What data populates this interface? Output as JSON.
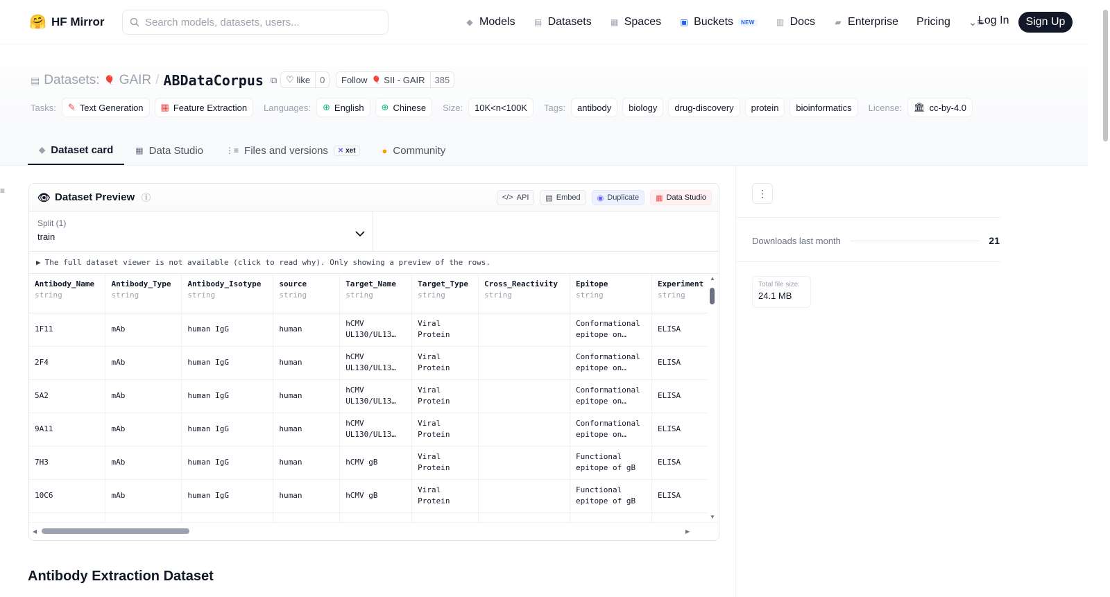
{
  "nav": {
    "logo_text": "HF Mirror",
    "logo_icon": "hugging-face-emoji",
    "search_placeholder": "Search models, datasets, users...",
    "links": [
      {
        "label": "Models",
        "icon": "cube-icon"
      },
      {
        "label": "Datasets",
        "icon": "database-icon"
      },
      {
        "label": "Spaces",
        "icon": "grid-icon"
      },
      {
        "label": "Buckets",
        "icon": "bucket-icon",
        "badge": "NEW"
      },
      {
        "label": "Docs",
        "icon": "book-icon"
      },
      {
        "label": "Enterprise",
        "icon": "enterprise-icon"
      },
      {
        "label": "Pricing"
      }
    ],
    "login": "Log In",
    "signup": "Sign Up"
  },
  "header": {
    "section": "Datasets:",
    "org": "GAIR",
    "separator": "/",
    "name": "ABDataCorpus",
    "like_label": "like",
    "like_count": "0",
    "follow_label": "Follow",
    "follow_org": "SII - GAIR",
    "follow_count": "385"
  },
  "tags": {
    "tasks_label": "Tasks:",
    "tasks": [
      "Text Generation",
      "Feature Extraction"
    ],
    "languages_label": "Languages:",
    "languages": [
      "English",
      "Chinese"
    ],
    "size_label": "Size:",
    "size": "10K<n<100K",
    "tags_label": "Tags:",
    "tags": [
      "antibody",
      "biology",
      "drug-discovery",
      "protein",
      "bioinformatics"
    ],
    "license_label": "License:",
    "license": "cc-by-4.0"
  },
  "tabs": [
    {
      "label": "Dataset card",
      "active": true
    },
    {
      "label": "Data Studio"
    },
    {
      "label": "Files and versions",
      "badge": "xet"
    },
    {
      "label": "Community"
    }
  ],
  "preview": {
    "title": "Dataset Preview",
    "buttons": {
      "api": "API",
      "embed": "Embed",
      "duplicate": "Duplicate",
      "data_studio": "Data Studio"
    },
    "split_label": "Split (1)",
    "split_value": "train",
    "notice": "The full dataset viewer is not available (click to read why). Only showing a preview of the rows.",
    "columns": [
      {
        "name": "Antibody_Name",
        "type": "string"
      },
      {
        "name": "Antibody_Type",
        "type": "string"
      },
      {
        "name": "Antibody_Isotype",
        "type": "string"
      },
      {
        "name": "source",
        "type": "string"
      },
      {
        "name": "Target_Name",
        "type": "string"
      },
      {
        "name": "Target_Type",
        "type": "string"
      },
      {
        "name": "Cross_Reactivity",
        "type": "string"
      },
      {
        "name": "Epitope",
        "type": "string"
      },
      {
        "name": "Experiment",
        "type": "string"
      }
    ],
    "rows": [
      [
        "1F11",
        "mAb",
        "human IgG",
        "human",
        "hCMV UL130/UL13…",
        "Viral Protein",
        "",
        "Conformational epitope on…",
        "ELISA"
      ],
      [
        "2F4",
        "mAb",
        "human IgG",
        "human",
        "hCMV UL130/UL13…",
        "Viral Protein",
        "",
        "Conformational epitope on…",
        "ELISA"
      ],
      [
        "5A2",
        "mAb",
        "human IgG",
        "human",
        "hCMV UL130/UL13…",
        "Viral Protein",
        "",
        "Conformational epitope on…",
        "ELISA"
      ],
      [
        "9A11",
        "mAb",
        "human IgG",
        "human",
        "hCMV UL130/UL13…",
        "Viral Protein",
        "",
        "Conformational epitope on…",
        "ELISA"
      ],
      [
        "7H3",
        "mAb",
        "human IgG",
        "human",
        "hCMV gB",
        "Viral Protein",
        "",
        "Functional epitope of gB",
        "ELISA"
      ],
      [
        "10C6",
        "mAb",
        "human IgG",
        "human",
        "hCMV gB",
        "Viral Protein",
        "",
        "Functional epitope of gB",
        "ELISA"
      ],
      [
        "",
        "",
        "",
        "",
        "",
        "Viral",
        "",
        "Functional",
        ""
      ]
    ]
  },
  "side": {
    "downloads_label": "Downloads last month",
    "downloads_value": "21",
    "filesize_label": "Total file size:",
    "filesize_value": "24.1 MB"
  },
  "card_heading": "Antibody Extraction Dataset",
  "colors": {
    "accent": "#111827",
    "tag_border": "#eceff3",
    "task_icon": "#ef4444",
    "lang_icon": "#10b981"
  }
}
